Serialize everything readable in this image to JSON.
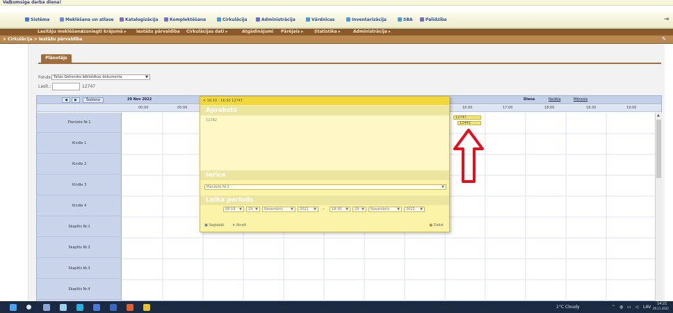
{
  "window": {
    "title": "Vaikumsiga darba diena!",
    "controls": "—   □   ✕"
  },
  "menu": {
    "items": [
      {
        "label": "Sistēma",
        "color": "#4a7ad8"
      },
      {
        "label": "Meklēšana un atlase",
        "color": "#6a8ae0"
      },
      {
        "label": "Katalogizācija",
        "color": "#7a6ad0"
      },
      {
        "label": "Komplektēšana",
        "color": "#7a6ad0"
      },
      {
        "label": "Cirkulācija",
        "color": "#4a9ad8"
      },
      {
        "label": "Administrācija",
        "color": "#6a6ad0"
      },
      {
        "label": "Vārdnīcas",
        "color": "#4a9ad8"
      },
      {
        "label": "Inventarizācija",
        "color": "#4a9ad8"
      },
      {
        "label": "SBA",
        "color": "#4a9ad8"
      },
      {
        "label": "Palīdzība",
        "color": "#6a6ad0"
      }
    ],
    "exit_icon": "⇥"
  },
  "submenu": {
    "items": [
      "Lasītāju meklēšana",
      "Izsniegti krājumā ▸",
      "Iestāžu pārvaldība",
      "Cirkulācijas dati ▸",
      "Atgādinājumi",
      "Pārējais ▸",
      "Statistika ▸",
      "Administrācija ▸"
    ]
  },
  "breadcrumb": {
    "text": "> Cirkulācija > Iestāžu pārvaldība",
    "pin": "✎"
  },
  "tab": {
    "label": "Plānotājs"
  },
  "form": {
    "fonds_label": "Fonds:",
    "fonds_value": "Tallas Gehendra bibliotēkas dokumenta",
    "lasit_label": "Lasīt.:",
    "lasit_value": "12747"
  },
  "calendar": {
    "nav_prev": "◀",
    "nav_next": "▶",
    "today": "Šodiena",
    "date": "29 Nov 2022",
    "views": {
      "day": "Diena",
      "week": "Nedēļa",
      "month": "Mēnesis"
    },
    "times_left": [
      "00:00",
      "05:00"
    ],
    "times_right": [
      "16:00",
      "17:00",
      "18:00",
      "18:30",
      "19:00"
    ],
    "resources": [
      "Planšete Nr.1",
      "Kindle 1",
      "Kindle 2",
      "Kindle 3",
      "Kindle 4",
      "Skapītis Nr.1",
      "Skapītis Nr.2",
      "Skapītis Nr.3",
      "Skapītis Nr.4"
    ],
    "events": [
      {
        "label": "12747"
      },
      {
        "label": "12442"
      }
    ]
  },
  "popup": {
    "header": "✕ 16:10 - 16:30   12747",
    "section_desc": "Apraksts",
    "desc_value": "12242",
    "section_device": "Ierīce",
    "device_value": "Planšete Nr.1",
    "section_period": "Laika periods",
    "start": {
      "time": "08:18",
      "day": "29",
      "month": "Novembris",
      "year": "2022"
    },
    "dash": "–",
    "end": {
      "time": "18:30",
      "day": "29",
      "month": "Novembris",
      "year": "2022"
    },
    "save": "Saglabāt",
    "cancel": "Atcelt",
    "delete": "Dzēst"
  },
  "taskbar": {
    "weather": "1°C Cloudy",
    "lang": "LAV",
    "time": "14:21",
    "date": "29.11.2022"
  },
  "colors": {
    "accent_brown": "#8b5a2b",
    "calendar_blue": "#c9d3ea",
    "popup_yellow": "#fbf3a8",
    "arrow_red": "#e2101a"
  }
}
